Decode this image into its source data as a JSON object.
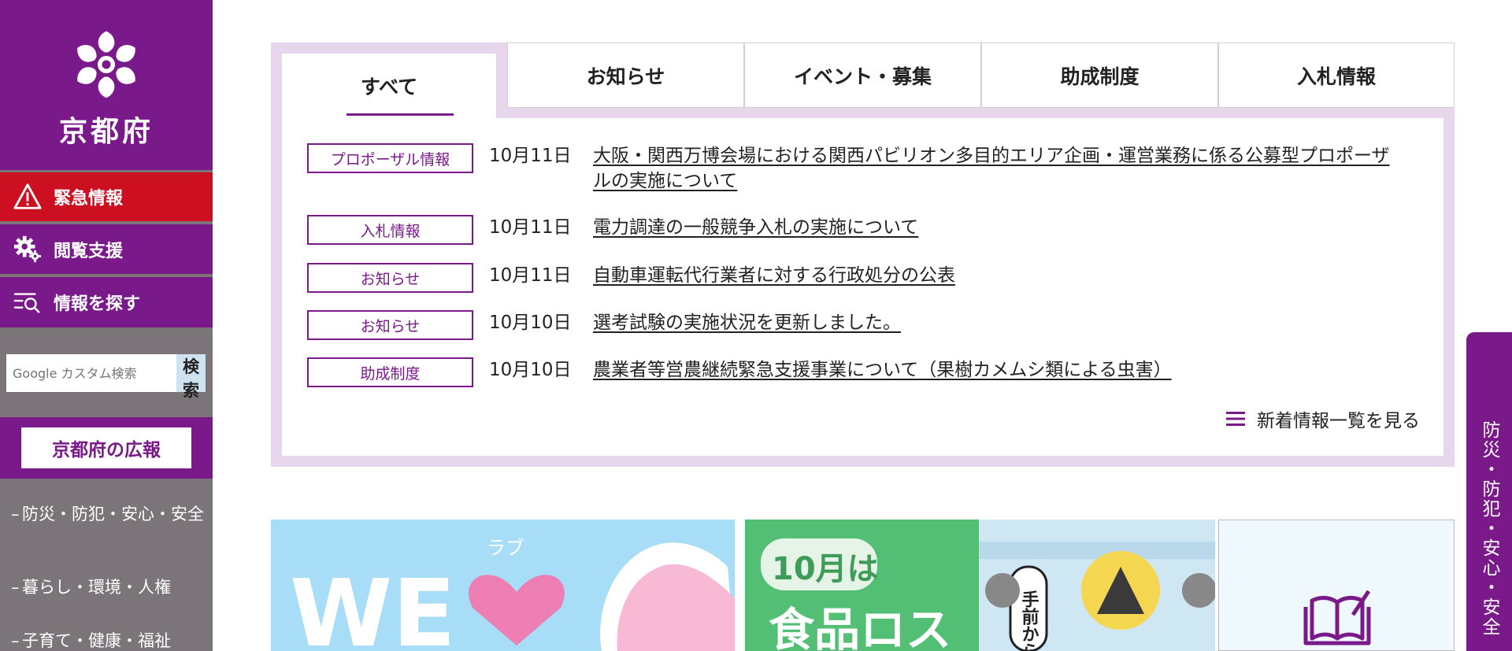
{
  "sidebar": {
    "logo_text": "京都府",
    "emergency_label": "緊急情報",
    "support_label": "閲覧支援",
    "find_label": "情報を探す",
    "search": {
      "placeholder": "Google カスタム検索",
      "button_label": "検索"
    },
    "pr_label": "京都府の広報",
    "categories": [
      "防災・防犯・安心・安全",
      "暮らし・環境・人権",
      "子育て・健康・福祉"
    ]
  },
  "news": {
    "tab_all": "すべて",
    "tabs": [
      "お知らせ",
      "イベント・募集",
      "助成制度",
      "入札情報"
    ],
    "items": [
      {
        "tag": "プロポーザル情報",
        "date": "10月11日",
        "title": "大阪・関西万博会場における関西パビリオン多目的エリア企画・運営業務に係る公募型プロポーザルの実施について"
      },
      {
        "tag": "入札情報",
        "date": "10月11日",
        "title": "電力調達の一般競争入札の実施について"
      },
      {
        "tag": "お知らせ",
        "date": "10月11日",
        "title": "自動車運転代行業者に対する行政処分の公表"
      },
      {
        "tag": "お知らせ",
        "date": "10月10日",
        "title": "選考試験の実施状況を更新しました。"
      },
      {
        "tag": "助成制度",
        "date": "10月10日",
        "title": "農業者等営農継続緊急支援事業について（果樹カメムシ類による虫害）"
      }
    ],
    "more_label": "新着情報一覧を見る"
  },
  "banners": {
    "banner_0": {
      "big_text": "WE",
      "ruby": "ラブ"
    },
    "banner_1": {
      "month": "10月は",
      "headline": "食品ロス",
      "slogan": "手前から"
    }
  },
  "side_tab": "防災・防犯・安心・安全",
  "colors": {
    "brand_purple": "#7a1a8a",
    "emergency_red": "#cc1021",
    "panel_lilac": "#e8d6ec",
    "sidebar_gray": "#7b7479"
  }
}
